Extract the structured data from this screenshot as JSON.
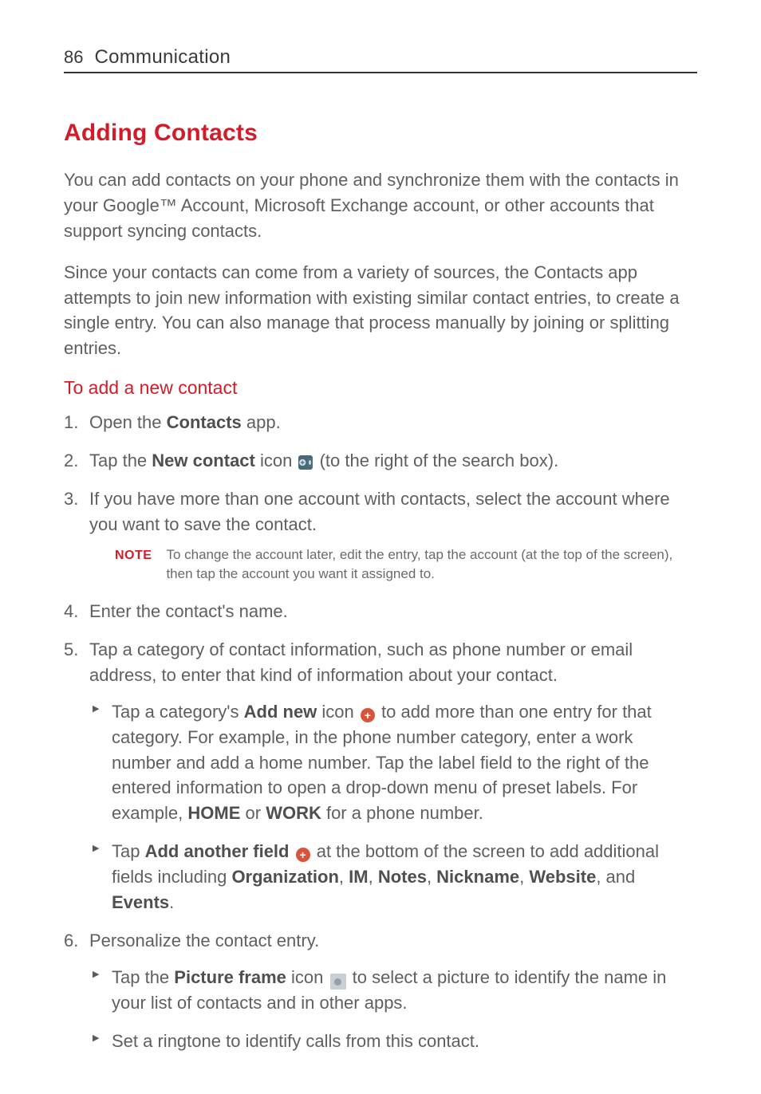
{
  "header": {
    "page_number": "86",
    "section": "Communication"
  },
  "heading": "Adding Contacts",
  "intro_p1": "You can add contacts on your phone and synchronize them with the contacts in your Google™ Account, Microsoft Exchange account, or other accounts that support syncing contacts.",
  "intro_p2": "Since your contacts can come from a variety of sources, the Contacts app attempts to join new information with existing similar contact entries, to create a single entry. You can also manage that process manually by joining or splitting entries.",
  "sub_heading": "To add a new contact",
  "steps": {
    "s1_a": "Open the ",
    "s1_bold": "Contacts",
    "s1_b": " app.",
    "s2_a": "Tap the ",
    "s2_bold": "New contact",
    "s2_b": " icon ",
    "s2_c": " (to the right of the search box).",
    "s3": "If you have more than one account with contacts, select the account where you want to save the contact.",
    "note_label": "NOTE",
    "note_text": "To change the account later, edit the entry, tap the account (at the top of the screen), then tap the account you want it assigned to.",
    "s4": "Enter the contact's name.",
    "s5": "Tap a category of contact information, such as phone number or email address, to enter that kind of information about your contact.",
    "s5_b1_a": "Tap a category's ",
    "s5_b1_bold1": "Add new",
    "s5_b1_b": " icon ",
    "s5_b1_c": " to add more than one entry for that category. For example, in the phone number category, enter a work number and add a home number. Tap the label field to the right of the entered information to open a drop-down menu of preset labels. For example, ",
    "s5_b1_bold2": "HOME",
    "s5_b1_d": " or ",
    "s5_b1_bold3": "WORK",
    "s5_b1_e": " for a phone number.",
    "s5_b2_a": "Tap ",
    "s5_b2_bold1": "Add another field",
    "s5_b2_b": " ",
    "s5_b2_c": " at the bottom of the screen to add additional fields including ",
    "s5_b2_bold2": "Organization",
    "s5_b2_d": ", ",
    "s5_b2_bold3": "IM",
    "s5_b2_e": ", ",
    "s5_b2_bold4": "Notes",
    "s5_b2_f": ", ",
    "s5_b2_bold5": "Nickname",
    "s5_b2_g": ", ",
    "s5_b2_bold6": "Website",
    "s5_b2_h": ", and ",
    "s5_b2_bold7": "Events",
    "s5_b2_i": ".",
    "s6": "Personalize the contact entry.",
    "s6_b1_a": "Tap the ",
    "s6_b1_bold": "Picture frame",
    "s6_b1_b": " icon ",
    "s6_b1_c": " to select a picture to identify the name in your list of contacts and in other apps.",
    "s6_b2": "Set a ringtone to identify calls from this contact."
  }
}
